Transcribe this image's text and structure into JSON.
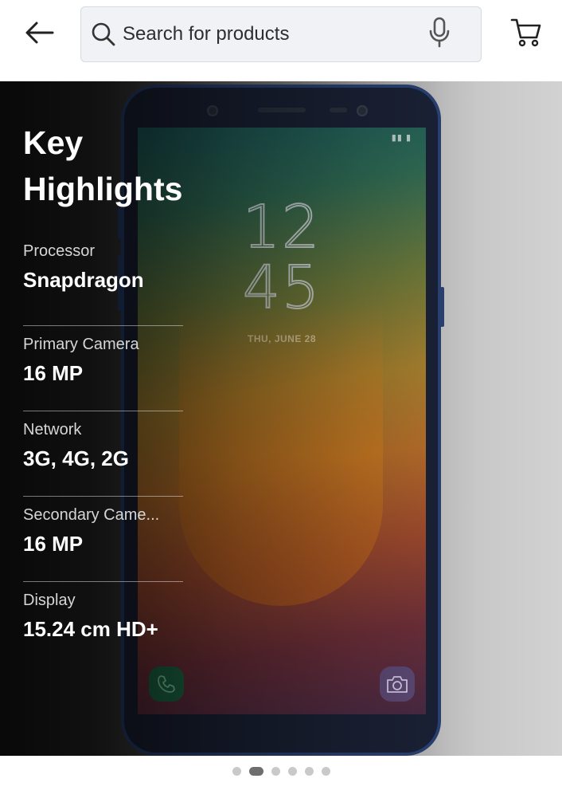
{
  "header": {
    "back_icon": "arrow-left-icon",
    "search": {
      "placeholder": "Search for products",
      "icon": "search-icon",
      "mic_icon": "microphone-icon"
    },
    "cart_icon": "shopping-cart-icon"
  },
  "product_image": {
    "lock_screen": {
      "hours": "12",
      "minutes": "45",
      "date": "THU, JUNE 28"
    },
    "app_icons": [
      "phone-icon",
      "camera-icon"
    ]
  },
  "key_highlights": {
    "title": "Key Highlights",
    "items": [
      {
        "label": "Processor",
        "value": "Snapdragon"
      },
      {
        "label": "Primary Camera",
        "value": "16 MP"
      },
      {
        "label": "Network",
        "value": "3G, 4G, 2G"
      },
      {
        "label": "Secondary Came...",
        "value": "16 MP"
      },
      {
        "label": "Display",
        "value": "15.24 cm HD+"
      }
    ]
  },
  "carousel": {
    "total": 6,
    "active_index": 1
  },
  "colors": {
    "phone_frame": "#2b4272",
    "accent_dot": "#6e6e6e",
    "search_bg": "#f0f2f5"
  }
}
